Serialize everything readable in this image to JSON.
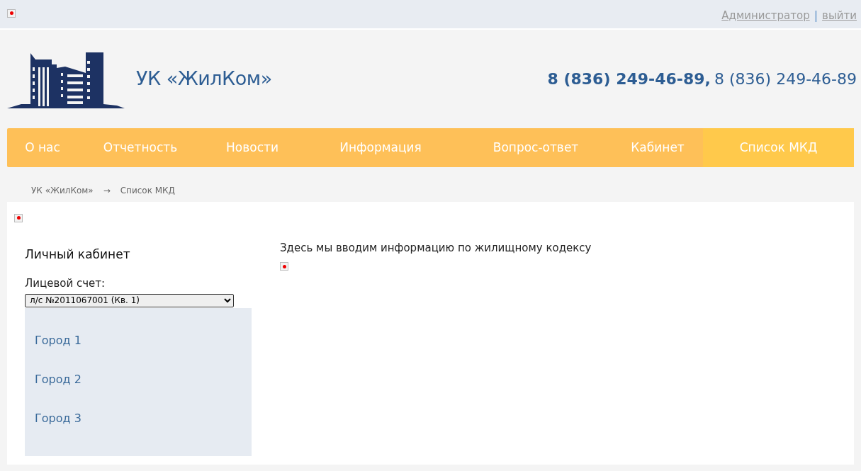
{
  "top_bar": {
    "user_link": "Администратор",
    "separator": "|",
    "logout_link": "выйти"
  },
  "header": {
    "brand": "УК «ЖилКом»",
    "phone_primary": "8 (836) 249-46-89,",
    "phone_secondary": "8 (836) 249-46-89"
  },
  "nav": [
    {
      "label": "О нас",
      "selected": false
    },
    {
      "label": "Отчетность",
      "selected": false
    },
    {
      "label": "Новости",
      "selected": false
    },
    {
      "label": "Информация",
      "selected": false
    },
    {
      "label": "Вопрос-ответ",
      "selected": false
    },
    {
      "label": "Кабинет",
      "selected": false
    },
    {
      "label": "Список МКД",
      "selected": true
    }
  ],
  "breadcrumbs": {
    "items": [
      "УК «ЖилКом»",
      "Список МКД"
    ],
    "separator": "→"
  },
  "sidebar": {
    "title": "Личный кабинет",
    "account_label": "Лицевой счет:",
    "account_value": "л/с №2011067001 (Кв. 1)",
    "items": [
      "Город 1",
      "Город 2",
      "Город 3"
    ]
  },
  "content": {
    "text": "Здесь мы вводим информацию по жилищному кодексу"
  }
}
